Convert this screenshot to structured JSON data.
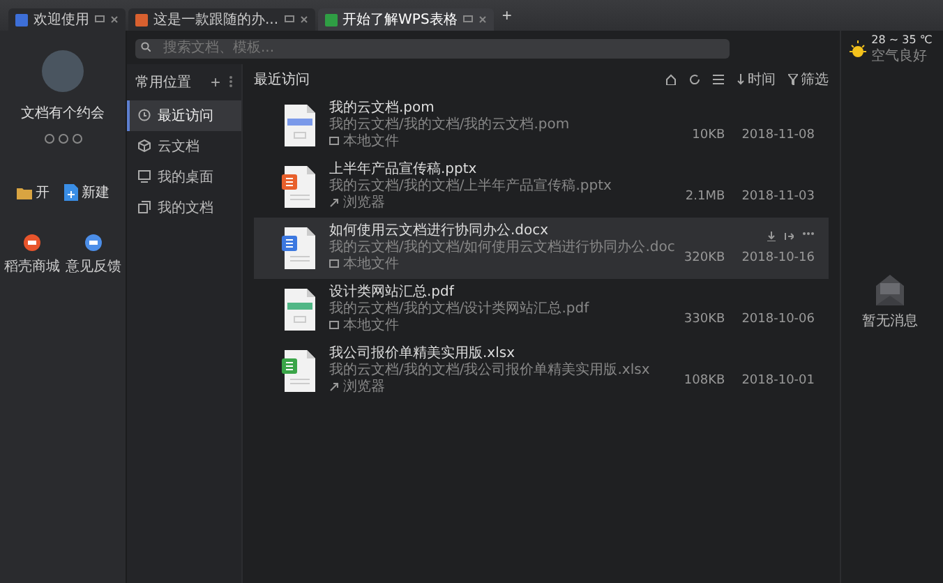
{
  "tabs": [
    {
      "label": "欢迎使用",
      "kind": "home",
      "selected": false
    },
    {
      "label": "这是一款跟随的办...",
      "kind": "ppt",
      "selected": false
    },
    {
      "label": "开始了解WPS表格",
      "kind": "sheet",
      "selected": true
    }
  ],
  "new_tab": "+",
  "search": {
    "placeholder": "搜索文档、模板..."
  },
  "profile": {
    "name": "文档有个约会"
  },
  "quick_actions": [
    {
      "label": "开",
      "kind": "open"
    },
    {
      "label": "新建",
      "kind": "new"
    }
  ],
  "bottom_links": [
    {
      "label": "稻壳商城",
      "kind": "store"
    },
    {
      "label": "意见反馈",
      "kind": "feedback"
    }
  ],
  "nav": {
    "title": "常用位置",
    "add": "+",
    "items": [
      {
        "label": "最近访问",
        "kind": "recent",
        "selected": true
      },
      {
        "label": "云文档",
        "kind": "cloud",
        "selected": false
      },
      {
        "label": "我的桌面",
        "kind": "desktop",
        "selected": false
      },
      {
        "label": "我的文档",
        "kind": "docs",
        "selected": false
      }
    ]
  },
  "main": {
    "title": "最近访问",
    "sort": "时间",
    "filter": "筛选",
    "files": [
      {
        "name": "我的云文档.pom",
        "kind": "pom",
        "path": "我的云文档/我的文档/我的云文档.pom",
        "location": {
          "label": "本地文件",
          "kind": "local"
        },
        "size": "10KB",
        "date": "2018-11-08",
        "selected": false
      },
      {
        "name": "上半年产品宣传稿.pptx",
        "kind": "pptx",
        "path": "我的云文档/我的文档/上半年产品宣传稿.pptx",
        "location": {
          "label": "浏览器",
          "kind": "browser"
        },
        "size": "2.1MB",
        "date": "2018-11-03",
        "selected": false
      },
      {
        "name": "如何使用云文档进行协同办公.docx",
        "kind": "docx",
        "path": "我的云文档/我的文档/如何使用云文档进行协同办公.doc",
        "location": {
          "label": "本地文件",
          "kind": "local"
        },
        "size": "320KB",
        "date": "2018-10-16",
        "selected": true
      },
      {
        "name": "设计类网站汇总.pdf",
        "kind": "pdf",
        "path": "我的云文档/我的文档/设计类网站汇总.pdf",
        "location": {
          "label": "本地文件",
          "kind": "local"
        },
        "size": "330KB",
        "date": "2018-10-06",
        "selected": false
      },
      {
        "name": "我公司报价单精美实用版.xlsx",
        "kind": "xlsx",
        "path": "我的云文档/我的文档/我公司报价单精美实用版.xlsx",
        "location": {
          "label": "浏览器",
          "kind": "browser"
        },
        "size": "108KB",
        "date": "2018-10-01",
        "selected": false
      }
    ]
  },
  "weather": {
    "temperature": "28 ~ 35 ℃",
    "air": "空气良好"
  },
  "messages": {
    "empty": "暂无消息"
  }
}
